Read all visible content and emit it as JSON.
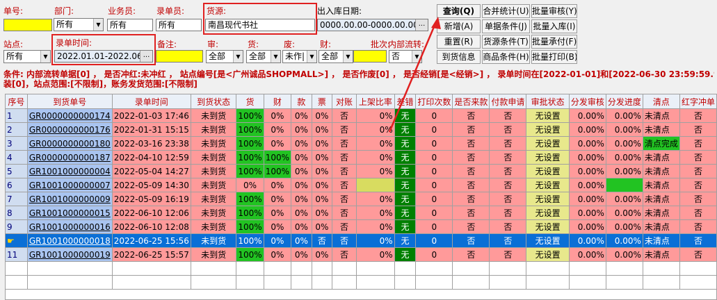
{
  "filters": {
    "order_no_label": "单号:",
    "dept_label": "部门:",
    "dept_value": "所有",
    "salesman_label": "业务员:",
    "salesman_value": "所有",
    "entry_person_label": "录单员:",
    "entry_person_value": "所有",
    "source_label": "货源:",
    "source_value": "南昌现代书社",
    "io_date_label": "出入库日期:",
    "io_date_value": "0000.00.00-0000.00.00",
    "station_label": "站点:",
    "station_value": "所有",
    "entry_time_label": "录单时间:",
    "entry_time_value": "2022.01.01-2022.06.30",
    "remark_label": "备注:",
    "audit_label": "审:",
    "audit_value": "全部",
    "goods_label": "货:",
    "goods_value": "全部",
    "void_label": "废:",
    "void_value": "未作|",
    "finance_label": "财:",
    "finance_value": "全部",
    "batch_label": "批次:",
    "internal_label": "内部流转:",
    "internal_value": "否",
    "dots": "..."
  },
  "buttons": {
    "query": "查询(Q)",
    "merge_stats": "合并统计(U)",
    "batch_audit": "批量审核(Y)",
    "add": "新增(A)",
    "doc_condition": "单据条件(J)",
    "batch_in": "批量入库(I)",
    "reset": "重置(R)",
    "source_condition": "货源条件(T)",
    "batch_accept": "批量承付(F)",
    "arrival_info": "到货信息",
    "goods_condition": "商品条件(H)",
    "batch_print": "批量打印(B)"
  },
  "condition_text": {
    "line1": "条件: 内部流转单据[0] ， 是否冲红:未冲红 ， 站点编号[是<广州诚品SHOPMALL>] ， 是否作废[0] ， 是否经销[是<经销>] ， 录单时间在[2022-01-01]和[2022-06-30 23:59:59.998]之间 ， 货源",
    "line2": "装[0]，站点范围:[不限制]，账务发货范围:[不限制]"
  },
  "table": {
    "headers": [
      "序号",
      "到货单号",
      "录单时间",
      "到货状态",
      "货",
      "财",
      "款",
      "票",
      "对账",
      "上架比率",
      "差错",
      "打印次数",
      "是否来款",
      "付款申请",
      "审批状态",
      "分发审核",
      "分发进度",
      "清点",
      "红字冲单"
    ],
    "rows": [
      {
        "idx": "1",
        "no": "GR0000000000174",
        "time": "2022-01-03 17:46",
        "status": "未到货",
        "goods": "100%",
        "fin": "0%",
        "pay": "0%",
        "inv": "0%",
        "rec": "否",
        "ratio": "0%",
        "err": "无",
        "print": "0",
        "came": "否",
        "apply": "否",
        "approve": "无设置",
        "dist_audit": "0.00%",
        "dist_prog": "0.00%",
        "count": "未清点",
        "red": "否"
      },
      {
        "idx": "2",
        "no": "GR0000000000176",
        "time": "2022-01-31 15:15",
        "status": "未到货",
        "goods": "100%",
        "fin": "0%",
        "pay": "0%",
        "inv": "0%",
        "rec": "否",
        "ratio": "0%",
        "err": "无",
        "print": "0",
        "came": "否",
        "apply": "否",
        "approve": "无设置",
        "dist_audit": "0.00%",
        "dist_prog": "0.00%",
        "count": "未清点",
        "red": "否"
      },
      {
        "idx": "3",
        "no": "GR0000000000180",
        "time": "2022-03-16 23:38",
        "status": "未到货",
        "goods": "100%",
        "fin": "0%",
        "pay": "0%",
        "inv": "0%",
        "rec": "否",
        "ratio": "0%",
        "err": "无",
        "print": "0",
        "came": "否",
        "apply": "否",
        "approve": "无设置",
        "dist_audit": "0.00%",
        "dist_prog": "0.00%",
        "count": "清点完成",
        "red": "否"
      },
      {
        "idx": "4",
        "no": "GR0000000000187",
        "time": "2022-04-10 12:59",
        "status": "未到货",
        "goods": "100%",
        "fin": "100%",
        "pay": "0%",
        "inv": "0%",
        "rec": "否",
        "ratio": "0%",
        "err": "无",
        "print": "0",
        "came": "否",
        "apply": "否",
        "approve": "无设置",
        "dist_audit": "0.00%",
        "dist_prog": "0.00%",
        "count": "未清点",
        "red": "否"
      },
      {
        "idx": "5",
        "no": "GR1001000000004",
        "time": "2022-05-04 14:27",
        "status": "未到货",
        "goods": "100%",
        "fin": "100%",
        "pay": "0%",
        "inv": "0%",
        "rec": "否",
        "ratio": "0%",
        "err": "无",
        "print": "0",
        "came": "否",
        "apply": "否",
        "approve": "无设置",
        "dist_audit": "0.00%",
        "dist_prog": "0.00%",
        "count": "未清点",
        "red": "否"
      },
      {
        "idx": "6",
        "no": "GR1001000000007",
        "time": "2022-05-09 14:30",
        "status": "未到货",
        "goods": "0%",
        "fin": "0%",
        "pay": "0%",
        "inv": "0%",
        "rec": "否",
        "ratio": "",
        "err": "无",
        "print": "0",
        "came": "否",
        "apply": "否",
        "approve": "无设置",
        "dist_audit": "0.00%",
        "dist_prog": "",
        "count": "未清点",
        "red": "否"
      },
      {
        "idx": "7",
        "no": "GR1001000000009",
        "time": "2022-05-09 16:19",
        "status": "未到货",
        "goods": "100%",
        "fin": "0%",
        "pay": "0%",
        "inv": "0%",
        "rec": "否",
        "ratio": "0%",
        "err": "无",
        "print": "0",
        "came": "否",
        "apply": "否",
        "approve": "无设置",
        "dist_audit": "0.00%",
        "dist_prog": "0.00%",
        "count": "未清点",
        "red": "否"
      },
      {
        "idx": "8",
        "no": "GR1001000000015",
        "time": "2022-06-10 12:06",
        "status": "未到货",
        "goods": "100%",
        "fin": "0%",
        "pay": "0%",
        "inv": "0%",
        "rec": "否",
        "ratio": "0%",
        "err": "无",
        "print": "0",
        "came": "否",
        "apply": "否",
        "approve": "无设置",
        "dist_audit": "0.00%",
        "dist_prog": "0.00%",
        "count": "未清点",
        "red": "否"
      },
      {
        "idx": "9",
        "no": "GR1001000000016",
        "time": "2022-06-10 12:08",
        "status": "未到货",
        "goods": "100%",
        "fin": "0%",
        "pay": "0%",
        "inv": "0%",
        "rec": "否",
        "ratio": "0%",
        "err": "无",
        "print": "0",
        "came": "否",
        "apply": "否",
        "approve": "无设置",
        "dist_audit": "0.00%",
        "dist_prog": "0.00%",
        "count": "未清点",
        "red": "否"
      },
      {
        "idx": "",
        "no": "GR1001000000018",
        "time": "2022-06-25 15:56",
        "status": "未到货",
        "goods": "100%",
        "fin": "0%",
        "pay": "0%",
        "inv": "否",
        "rec": "否",
        "ratio": "0%",
        "err": "无",
        "print": "0",
        "came": "否",
        "apply": "否",
        "approve": "无设置",
        "dist_audit": "0.00%",
        "dist_prog": "0.00%",
        "count": "未清点",
        "red": "否"
      },
      {
        "idx": "11",
        "no": "GR1001000000019",
        "time": "2022-06-25 15:57",
        "status": "未到货",
        "goods": "100%",
        "fin": "0%",
        "pay": "0%",
        "inv": "0%",
        "rec": "否",
        "ratio": "0%",
        "err": "无",
        "print": "0",
        "came": "否",
        "apply": "否",
        "approve": "无设置",
        "dist_audit": "0.00%",
        "dist_prog": "0.00%",
        "count": "未清点",
        "red": "否"
      }
    ]
  }
}
